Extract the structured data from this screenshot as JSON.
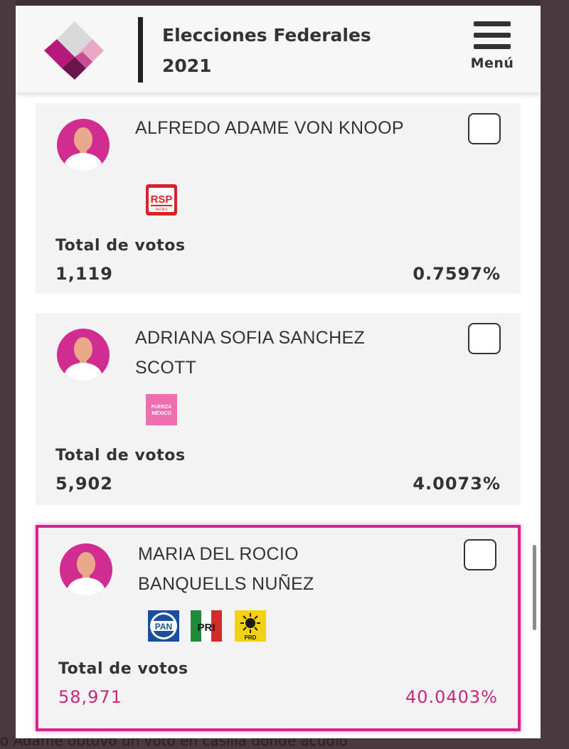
{
  "header": {
    "title_line1": "Elecciones Federales",
    "title_line2": "2021",
    "menu_label": "Menú"
  },
  "background": {
    "bottom_text": "o Adame obtuvo un voto en casilla donde acudió"
  },
  "candidates": [
    {
      "name_line1": "ALFREDO ADAME VON KNOOP",
      "name_line2": "",
      "parties": [
        "RSP"
      ],
      "votes_label": "Total de votos",
      "votes": "1,119",
      "percent": "0.7597%",
      "selected": false
    },
    {
      "name_line1": "ADRIANA SOFIA SANCHEZ",
      "name_line2": "SCOTT",
      "parties": [
        "FUERZA MÉXICO"
      ],
      "votes_label": "Total de votos",
      "votes": "5,902",
      "percent": "4.0073%",
      "selected": false
    },
    {
      "name_line1": "MARIA DEL ROCIO",
      "name_line2": "BANQUELLS NUÑEZ",
      "parties": [
        "PAN",
        "PRI",
        "PRD"
      ],
      "votes_label": "Total de votos",
      "votes": "58,971",
      "percent": "40.0403%",
      "selected": false,
      "highlighted": true
    }
  ],
  "party_logos": {
    "rsp_text": "RSP",
    "rsp_sub": "REDES",
    "fuerza_line1": "FUERZA",
    "fuerza_line2": "MÉXICO",
    "pan_text": "PAN",
    "pri_text": "PRI",
    "prd_text": "PRD"
  },
  "colors": {
    "accent": "#d5248a",
    "highlight_text": "#c4287f",
    "card_bg": "#f3f3f3"
  }
}
